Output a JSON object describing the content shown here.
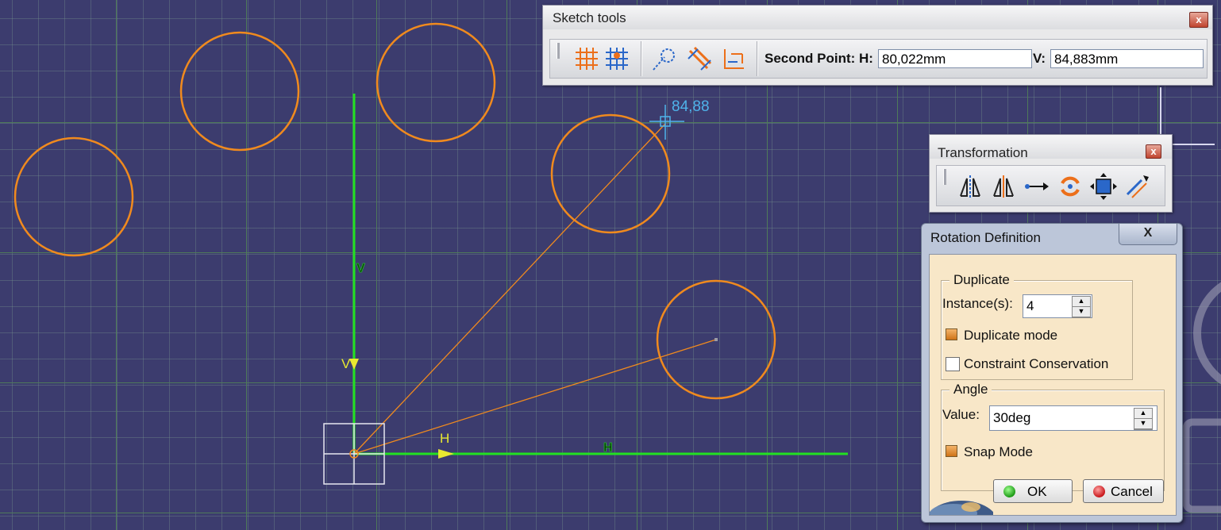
{
  "sketch": {
    "dimension_text": "84,88",
    "axis_v_label": "V",
    "axis_h_label": "H",
    "cursor_v_label": "V",
    "cursor_h_label": "H"
  },
  "sketch_tools": {
    "title": "Sketch tools",
    "second_point_label": "Second Point: H:",
    "h_value": "80,022mm",
    "v_label": "V:",
    "v_value": "84,883mm",
    "icons": [
      "grid-icon",
      "snap-to-point-icon",
      "construction-element-icon",
      "geometrical-constraints-icon",
      "dimensional-constraints-icon"
    ]
  },
  "transformation": {
    "title": "Transformation",
    "icons": [
      "mirror-icon",
      "symmetry-icon",
      "translate-icon",
      "rotate-icon",
      "scale-icon",
      "offset-icon"
    ]
  },
  "rotation_dialog": {
    "title": "Rotation Definition",
    "close": "X",
    "duplicate_group": "Duplicate",
    "instances_label": "Instance(s):",
    "instances_value": "4",
    "duplicate_mode_label": "Duplicate mode",
    "duplicate_mode_checked": true,
    "constraint_conservation_label": "Constraint Conservation",
    "constraint_conservation_checked": false,
    "angle_group": "Angle",
    "value_label": "Value:",
    "angle_value": "30deg",
    "snap_mode_label": "Snap Mode",
    "snap_mode_checked": true,
    "ok_label": "OK",
    "cancel_label": "Cancel"
  },
  "colors": {
    "background": "#3c3c6e",
    "geometry": "#f08a1e",
    "axis": "#22e022",
    "dimension": "#4fb3ea",
    "dialog_client": "#f8e7c8"
  }
}
